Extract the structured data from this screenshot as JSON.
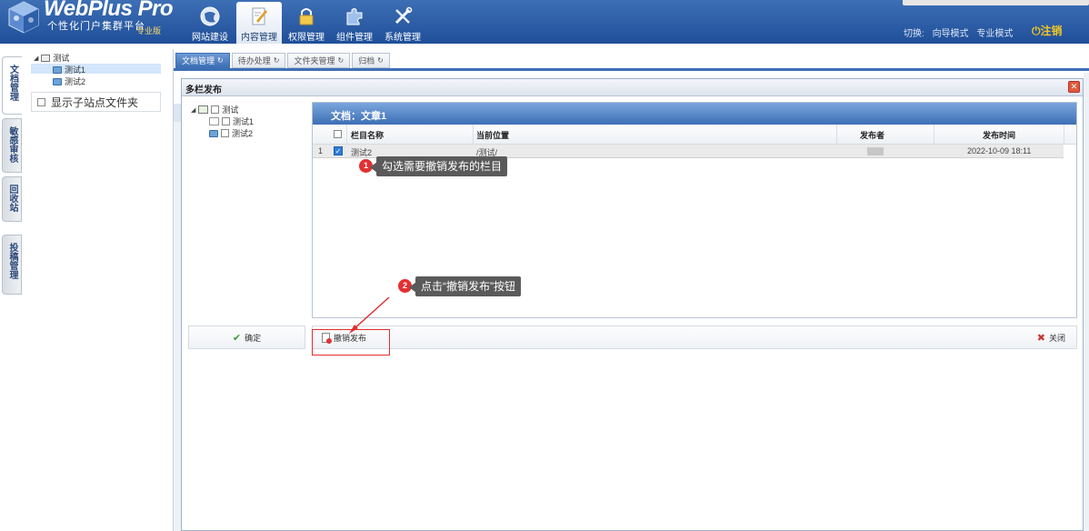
{
  "app": {
    "title": "WebPlus Pro",
    "subtitle": "个性化门户集群平台",
    "edition": "专业版"
  },
  "nav": [
    {
      "label": "网站建设",
      "icon": "globe-icon"
    },
    {
      "label": "内容管理",
      "icon": "edit-document-icon"
    },
    {
      "label": "权限管理",
      "icon": "lock-icon"
    },
    {
      "label": "组件管理",
      "icon": "puzzle-icon"
    },
    {
      "label": "系统管理",
      "icon": "tools-icon"
    }
  ],
  "header": {
    "switch_label": "切换:",
    "guide_mode": "向导模式",
    "expert_mode": "专业模式",
    "logout": "注销"
  },
  "left_tabs": [
    "文档管理",
    "敏感审核",
    "回收站",
    "投稿管理"
  ],
  "tree": {
    "root": "测试",
    "children": [
      "测试1",
      "测试2"
    ],
    "show_sub_label": "显示子站点文件夹"
  },
  "content_tabs": [
    {
      "label": "文档管理"
    },
    {
      "label": "待办处理"
    },
    {
      "label": "文件夹管理"
    },
    {
      "label": "归档"
    }
  ],
  "modal": {
    "title": "多栏发布",
    "tree_root": "测试",
    "tree_children": [
      "测试1",
      "测试2"
    ],
    "grid_title": "文档：文章1",
    "columns": [
      "栏目名称",
      "当前位置",
      "发布者",
      "发布时间"
    ],
    "rows": [
      {
        "index": "1",
        "name": "测试2",
        "location": "/测试/",
        "publisher": "",
        "time": "2022-10-09 18:11",
        "checked": true
      }
    ],
    "ok_label": "确定",
    "unpublish_label": "撤销发布",
    "close_label": "关闭"
  },
  "callouts": [
    {
      "number": "1",
      "text": "勾选需要撤销发布的栏目"
    },
    {
      "number": "2",
      "text": "点击“撤销发布”按钮"
    }
  ],
  "colors": {
    "header_bg": "#2a5ba5",
    "accent": "#3d6fb5",
    "logout": "#f3c623",
    "callout_bg": "#5a5a5a",
    "badge": "#e33030",
    "highlight_box": "#e0302f"
  }
}
